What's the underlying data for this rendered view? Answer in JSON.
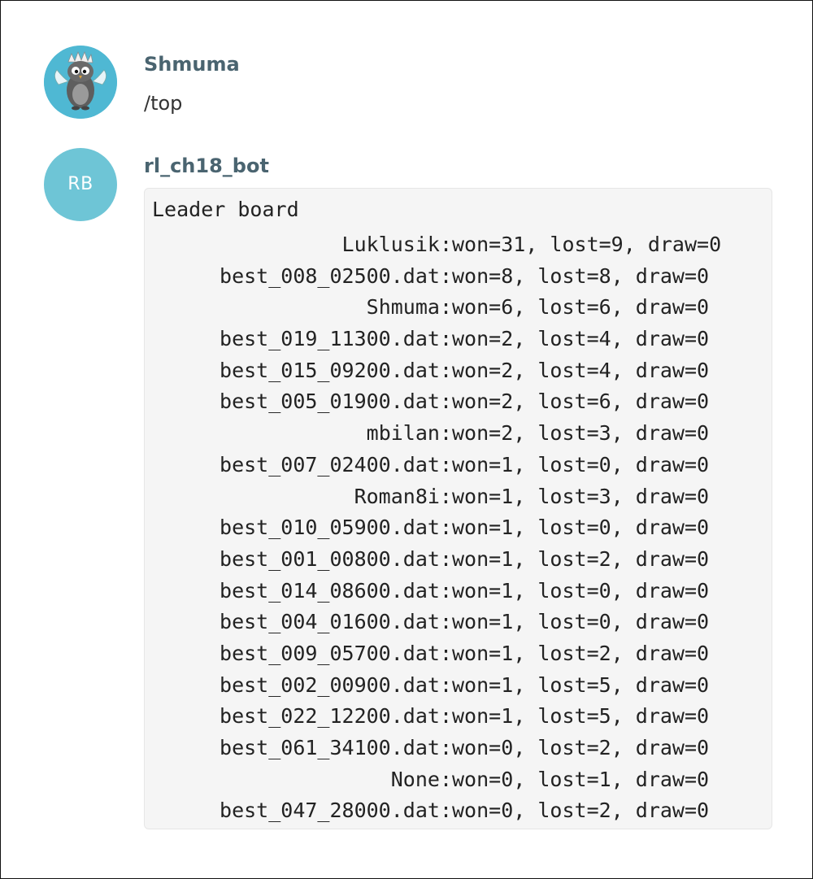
{
  "messages": [
    {
      "sender": "Shmuma",
      "avatar": {
        "type": "image",
        "icon": "owl-character-avatar",
        "bg_color": "#4fb8d3"
      },
      "text": "/top"
    },
    {
      "sender": "rl_ch18_bot",
      "avatar": {
        "type": "initials",
        "initials": "RB",
        "bg_color": "#6ec5d6"
      },
      "code_title": "Leader board",
      "leaderboard": [
        {
          "name": "Luklusik",
          "stats": "won=31, lost=9, draw=0"
        },
        {
          "name": "best_008_02500.dat",
          "stats": "won=8, lost=8, draw=0"
        },
        {
          "name": "Shmuma",
          "stats": "won=6, lost=6, draw=0"
        },
        {
          "name": "best_019_11300.dat",
          "stats": "won=2, lost=4, draw=0"
        },
        {
          "name": "best_015_09200.dat",
          "stats": "won=2, lost=4, draw=0"
        },
        {
          "name": "best_005_01900.dat",
          "stats": "won=2, lost=6, draw=0"
        },
        {
          "name": "mbilan",
          "stats": "won=2, lost=3, draw=0"
        },
        {
          "name": "best_007_02400.dat",
          "stats": "won=1, lost=0, draw=0"
        },
        {
          "name": "Roman8i",
          "stats": "won=1, lost=3, draw=0"
        },
        {
          "name": "best_010_05900.dat",
          "stats": "won=1, lost=0, draw=0"
        },
        {
          "name": "best_001_00800.dat",
          "stats": "won=1, lost=2, draw=0"
        },
        {
          "name": "best_014_08600.dat",
          "stats": "won=1, lost=0, draw=0"
        },
        {
          "name": "best_004_01600.dat",
          "stats": "won=1, lost=0, draw=0"
        },
        {
          "name": "best_009_05700.dat",
          "stats": "won=1, lost=2, draw=0"
        },
        {
          "name": "best_002_00900.dat",
          "stats": "won=1, lost=5, draw=0"
        },
        {
          "name": "best_022_12200.dat",
          "stats": "won=1, lost=5, draw=0"
        },
        {
          "name": "best_061_34100.dat",
          "stats": "won=0, lost=2, draw=0"
        },
        {
          "name": "None",
          "stats": "won=0, lost=1, draw=0"
        },
        {
          "name": "best_047_28000.dat",
          "stats": "won=0, lost=2, draw=0"
        }
      ]
    }
  ]
}
